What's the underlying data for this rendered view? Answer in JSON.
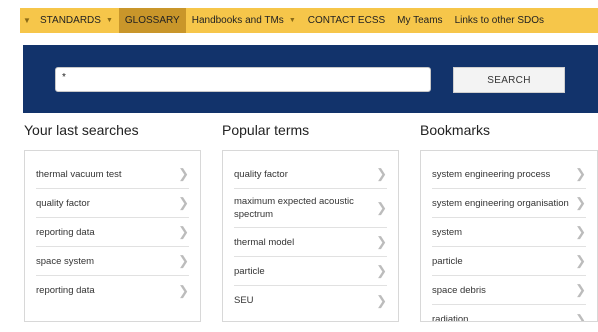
{
  "nav": {
    "items": [
      {
        "label": "STANDARDS"
      },
      {
        "label": "GLOSSARY"
      },
      {
        "label": "Handbooks and TMs"
      },
      {
        "label": "CONTACT ECSS"
      },
      {
        "label": "My Teams"
      },
      {
        "label": "Links to other SDOs"
      }
    ]
  },
  "search": {
    "value": "*",
    "button_label": "SEARCH"
  },
  "columns": [
    {
      "title": "Your last searches",
      "items": [
        "thermal vacuum test",
        "quality factor",
        "reporting data",
        "space system",
        "reporting data"
      ]
    },
    {
      "title": "Popular terms",
      "items": [
        "quality factor",
        "maximum expected acoustic spectrum",
        "thermal model",
        "particle",
        "SEU"
      ]
    },
    {
      "title": "Bookmarks",
      "items": [
        "system engineering process",
        "system engineering organisation",
        "system",
        "particle",
        "space debris",
        "radiation"
      ]
    }
  ],
  "colors": {
    "nav_bg": "#f6c64a",
    "nav_active": "#c9962a",
    "banner": "#12336b"
  }
}
